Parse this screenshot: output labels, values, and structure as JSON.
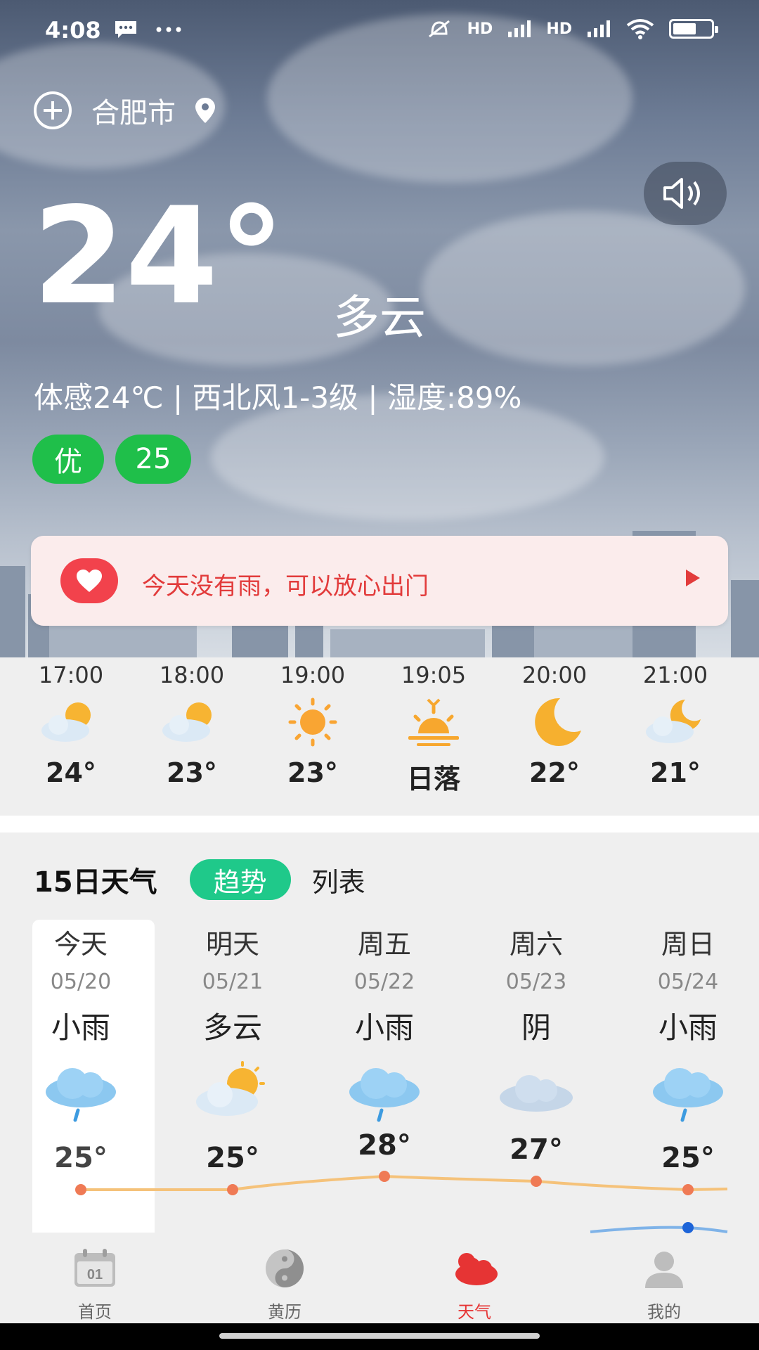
{
  "status": {
    "time": "4:08",
    "signal_tag": "HD",
    "battery_level": 0.55
  },
  "header": {
    "city": "合肥市"
  },
  "current": {
    "temperature": "24°",
    "condition": "多云",
    "details": "体感24℃ | 西北风1-3级 | 湿度:89%",
    "aqi_level": "优",
    "aqi_value": "25"
  },
  "alert": {
    "text": "今天没有雨，可以放心出门"
  },
  "hourly": [
    {
      "time": "17:00",
      "icon": "cloud-sun-icon",
      "temp": "24°"
    },
    {
      "time": "18:00",
      "icon": "cloud-sun-icon",
      "temp": "23°"
    },
    {
      "time": "19:00",
      "icon": "sun-icon",
      "temp": "23°"
    },
    {
      "time": "19:05",
      "icon": "sunset-icon",
      "temp": "日落"
    },
    {
      "time": "20:00",
      "icon": "moon-icon",
      "temp": "22°"
    },
    {
      "time": "21:00",
      "icon": "cloud-moon-icon",
      "temp": "21°"
    }
  ],
  "forecast": {
    "title": "15日天气",
    "trend_label": "趋势",
    "list_label": "列表",
    "days": [
      {
        "name": "今天",
        "date": "05/20",
        "condition": "小雨",
        "icon": "rain-icon",
        "high": "25°"
      },
      {
        "name": "明天",
        "date": "05/21",
        "condition": "多云",
        "icon": "cloud-sun-icon",
        "high": "25°"
      },
      {
        "name": "周五",
        "date": "05/22",
        "condition": "小雨",
        "icon": "rain-icon",
        "high": "28°"
      },
      {
        "name": "周六",
        "date": "05/23",
        "condition": "阴",
        "icon": "overcast-icon",
        "high": "27°"
      },
      {
        "name": "周日",
        "date": "05/24",
        "condition": "小雨",
        "icon": "rain-icon",
        "high": "25°"
      }
    ],
    "colors": {
      "high_line": "#f5c27a",
      "high_dot": "#ef7a55",
      "low_line": "#7fb3e8",
      "low_dot": "#1d64d8"
    }
  },
  "tabs": [
    {
      "label": "首页",
      "icon": "calendar-icon",
      "badge": "01",
      "active": false
    },
    {
      "label": "黄历",
      "icon": "yin-yang-icon",
      "active": false
    },
    {
      "label": "天气",
      "icon": "weather-cloud-icon",
      "active": true
    },
    {
      "label": "我的",
      "icon": "user-icon",
      "active": false
    }
  ],
  "theme": {
    "accent_green": "#1fbf4a",
    "trend_green": "#1fc98a",
    "alert_red": "#e23b3b",
    "active_tab_red": "#e63434"
  }
}
